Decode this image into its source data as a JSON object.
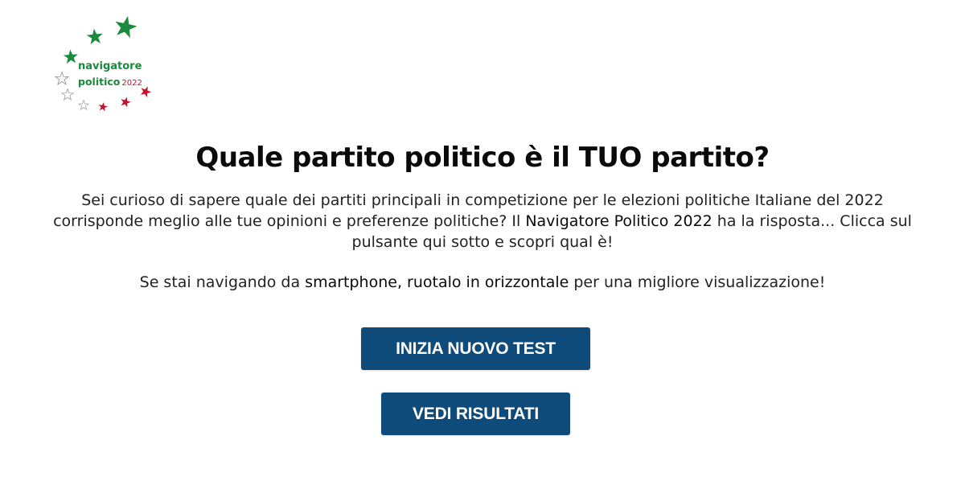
{
  "logo": {
    "line1": "navigatore",
    "line2": "politico",
    "year": "2022"
  },
  "colors": {
    "green": "#1a8a3c",
    "red": "#c8102e",
    "button": "#0e4a7a"
  },
  "heading": "Quale partito politico è il TUO partito?",
  "intro": {
    "part1": "Sei curioso di sapere quale dei partiti principali in competizione per le elezioni politiche Italiane del 2022 corrisponde meglio alle tue opinioni e preferenze politiche? Il ",
    "brand": "Navigatore Politico 2022",
    "part2": " ha la risposta... Clicca sul pulsante qui sotto e scopri qual è!"
  },
  "hint": {
    "part1": "Se stai navigando da ",
    "smartphone": "smartphone",
    "comma": ", ",
    "rotate": "ruotalo in orizzontale",
    "part2": " per una migliore visualizzazione!"
  },
  "buttons": {
    "new_test": "INIZIA NUOVO TEST",
    "results": "VEDI RISULTATI"
  }
}
